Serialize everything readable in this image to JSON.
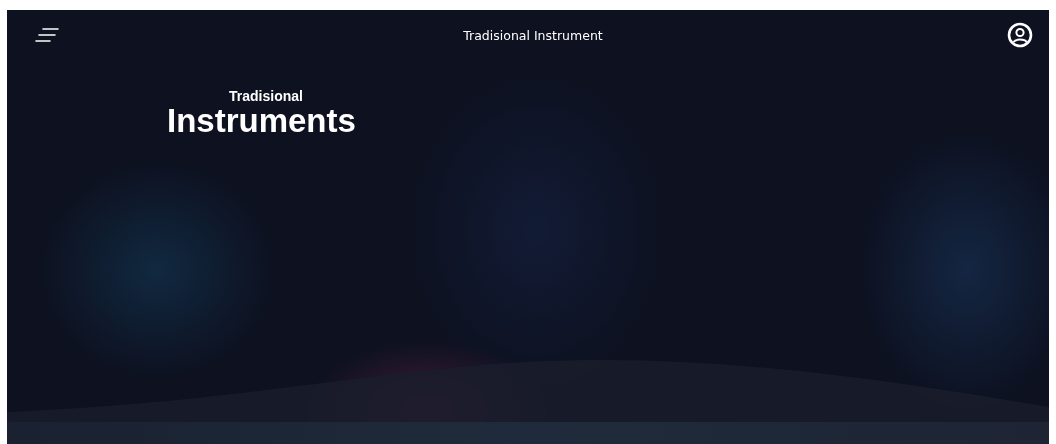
{
  "header": {
    "title": "Tradisional Instrument"
  },
  "hero": {
    "kicker": "Tradisional",
    "title": "Instruments"
  }
}
